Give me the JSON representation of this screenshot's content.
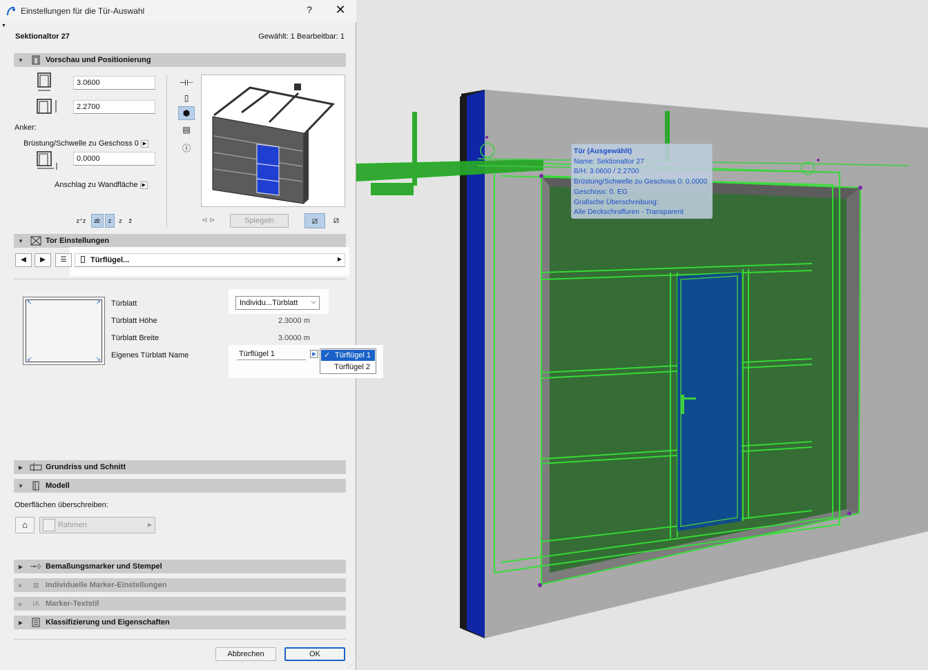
{
  "dialog": {
    "title": "Einstellungen für die Tür-Auswahl",
    "help": "?",
    "close": "✕",
    "object_name": "Sektionaltor 27",
    "selection_info": "Gewählt: 1 Bearbeitbar: 1"
  },
  "sections": {
    "vorschau": "Vorschau und Positionierung",
    "tor": "Tor Einstellungen",
    "grundriss": "Grundriss und Schnitt",
    "modell": "Modell",
    "bemassung": "Bemaßungsmarker und Stempel",
    "marker": "Individuelle Marker-Einstellungen",
    "marker_text": "Marker-Textstil",
    "klassifizierung": "Klassifizierung und Eigenschaften"
  },
  "vorschau": {
    "width_value": "3.0600",
    "height_value": "2.2700",
    "anchor_label": "Anker:",
    "sill_label": "Brüstung/Schwelle zu Geschoss 0",
    "sill_value": "0.0000",
    "reveal_label": "Anschlag zu Wandfläche",
    "mirror_label": "Spiegeln"
  },
  "tor": {
    "page_selector": "Türflügel...",
    "rows": [
      {
        "label": "Türblatt",
        "value": "Individu...Türblatt"
      },
      {
        "label": "Türblatt Höhe",
        "value": "2.3000 m"
      },
      {
        "label": "Türblatt Breite",
        "value": "3.0000 m"
      },
      {
        "label": "Eigenes Türblatt Name",
        "value": "Türflügel 1"
      }
    ],
    "popup_options": [
      "Türflügel 1",
      "Türflügel 2"
    ]
  },
  "modell": {
    "override_label": "Oberflächen überschreiben:",
    "surface_label": "Rahmen"
  },
  "footer": {
    "cancel": "Abbrechen",
    "ok": "OK"
  },
  "tooltip": {
    "title": "Tür (Ausgewählt)",
    "name": "Name: Sektionaltor 27",
    "size": "B/H: 3.0600 / 2.2700",
    "sill": "Brüstung/Schwelle zu Geschoss 0: 0.0000",
    "story": "Geschoss: 0. EG",
    "override": "Grafische Überschreibung:",
    "fills": "Alle Deckschraffuren - Transparent"
  },
  "colors": {
    "accent": "#1a62c7",
    "door_blue": "#1546b8",
    "selection_green": "#2fcf2f",
    "tooltip_text": "#1d4fc9"
  }
}
